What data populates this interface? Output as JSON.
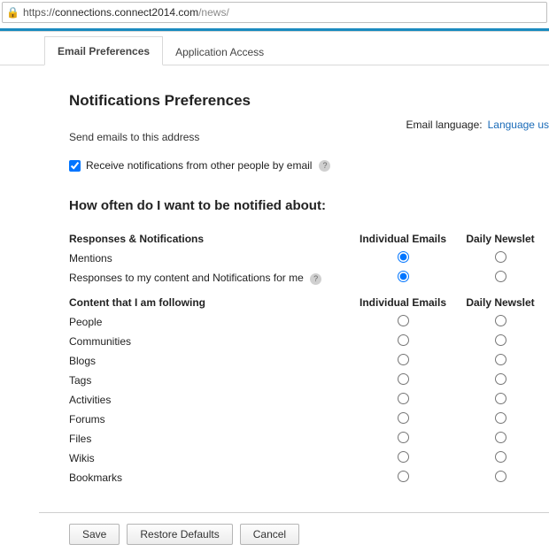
{
  "address_bar": {
    "scheme": "https://",
    "host": "connections.connect2014.com",
    "path": "/news/"
  },
  "tabs": [
    {
      "label": "Email Preferences",
      "active": true
    },
    {
      "label": "Application Access",
      "active": false
    }
  ],
  "page_title": "Notifications Preferences",
  "send_emails_label": "Send emails to this address",
  "receive_checkbox": {
    "label": "Receive notifications from other people by email",
    "checked": true
  },
  "email_language": {
    "label": "Email language:",
    "link": "Language us"
  },
  "how_often_heading": "How often do I want to be notified about:",
  "column_headers": {
    "individual": "Individual Emails",
    "daily": "Daily Newslet"
  },
  "group1": {
    "heading": "Responses & Notifications",
    "rows": [
      {
        "label": "Mentions",
        "selected": "individual"
      },
      {
        "label": "Responses to my content and Notifications for me",
        "selected": "individual",
        "help": true
      }
    ]
  },
  "group2": {
    "heading": "Content that I am following",
    "rows": [
      {
        "label": "People",
        "selected": ""
      },
      {
        "label": "Communities",
        "selected": ""
      },
      {
        "label": "Blogs",
        "selected": ""
      },
      {
        "label": "Tags",
        "selected": ""
      },
      {
        "label": "Activities",
        "selected": ""
      },
      {
        "label": "Forums",
        "selected": ""
      },
      {
        "label": "Files",
        "selected": ""
      },
      {
        "label": "Wikis",
        "selected": ""
      },
      {
        "label": "Bookmarks",
        "selected": ""
      }
    ]
  },
  "buttons": {
    "save": "Save",
    "restore": "Restore Defaults",
    "cancel": "Cancel"
  }
}
